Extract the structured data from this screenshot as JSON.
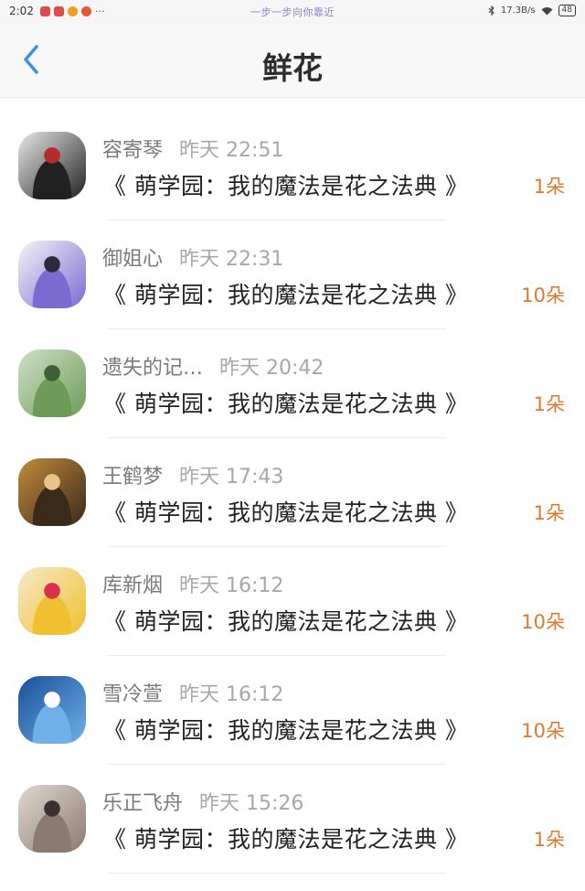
{
  "status_bar": {
    "time": "2:02",
    "center_text": "一步一步向你靠近",
    "network_speed": "17.3B/s",
    "battery": "48",
    "app_icon_colors": [
      "#e24a4a",
      "#e24a4a",
      "#f0a020",
      "#e25a30"
    ]
  },
  "header": {
    "title": "鲜花",
    "back_icon": "chevron-left-icon"
  },
  "colors": {
    "accent": "#3d8fe6",
    "count_color": "#e0782e"
  },
  "gifts": [
    {
      "user": "容寄琴",
      "time": "昨天 22:51",
      "book": "《 萌学园：我的魔法是花之法典 》",
      "count": "1朵",
      "avatar_colors": [
        "#e8e8e8",
        "#222222",
        "#b52a2a"
      ]
    },
    {
      "user": "御姐心",
      "time": "昨天 22:31",
      "book": "《 萌学园：我的魔法是花之法典 》",
      "count": "10朵",
      "avatar_colors": [
        "#f4f4f8",
        "#7b6ad0",
        "#2c2c3c"
      ]
    },
    {
      "user": "遗失的记…",
      "time": "昨天 20:42",
      "book": "《 萌学园：我的魔法是花之法典 》",
      "count": "1朵",
      "avatar_colors": [
        "#cfe0c4",
        "#6e9a5a",
        "#3e5f3a"
      ]
    },
    {
      "user": "王鹤梦",
      "time": "昨天 17:43",
      "book": "《 萌学园：我的魔法是花之法典 》",
      "count": "1朵",
      "avatar_colors": [
        "#c28a3a",
        "#3a2a1a",
        "#e8c48a"
      ]
    },
    {
      "user": "库新烟",
      "time": "昨天 16:12",
      "book": "《 萌学园：我的魔法是花之法典 》",
      "count": "10朵",
      "avatar_colors": [
        "#f6e9c8",
        "#f0c030",
        "#d8324a"
      ]
    },
    {
      "user": "雪冷萱",
      "time": "昨天 16:12",
      "book": "《 萌学园：我的魔法是花之法典 》",
      "count": "10朵",
      "avatar_colors": [
        "#1a4f9a",
        "#6fb0e8",
        "#ffffff"
      ]
    },
    {
      "user": "乐正飞舟",
      "time": "昨天 15:26",
      "book": "《 萌学园：我的魔法是花之法典 》",
      "count": "1朵",
      "avatar_colors": [
        "#e0d8d0",
        "#8a7a70",
        "#3a3030"
      ]
    }
  ]
}
